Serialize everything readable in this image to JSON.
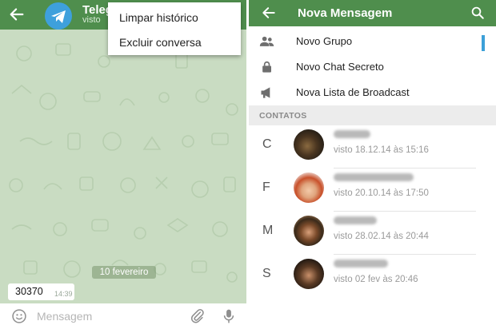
{
  "colors": {
    "header": "#4f8e4d",
    "chat_bg": "#c9dcc2",
    "accent": "#3ca0d8"
  },
  "left": {
    "header": {
      "title": "Teleg",
      "subtitle": "visto",
      "back_icon": "arrow-left-icon",
      "avatar_icon": "telegram-logo-icon"
    },
    "menu": {
      "items": [
        "Limpar histórico",
        "Excluir conversa"
      ]
    },
    "date_separator": "10 fevereiro",
    "message": {
      "text": "30370",
      "time": "14:39"
    },
    "input": {
      "placeholder": "Mensagem",
      "emoji_icon": "smiley-icon",
      "attach_icon": "paperclip-icon",
      "mic_icon": "microphone-icon"
    }
  },
  "right": {
    "header": {
      "title": "Nova Mensagem",
      "back_icon": "arrow-left-icon",
      "search_icon": "search-icon"
    },
    "options": [
      {
        "label": "Novo Grupo",
        "icon": "group-icon"
      },
      {
        "label": "Novo Chat Secreto",
        "icon": "lock-icon"
      },
      {
        "label": "Nova Lista de Broadcast",
        "icon": "megaphone-icon"
      }
    ],
    "section_label": "CONTATOS",
    "contacts": [
      {
        "letter": "C",
        "status": "visto 18.12.14 às 15:16"
      },
      {
        "letter": "F",
        "status": "visto 20.10.14 às 17:50"
      },
      {
        "letter": "M",
        "status": "visto 28.02.14 às 20:44"
      },
      {
        "letter": "S",
        "status": "visto 02 fev às 20:46"
      }
    ]
  }
}
